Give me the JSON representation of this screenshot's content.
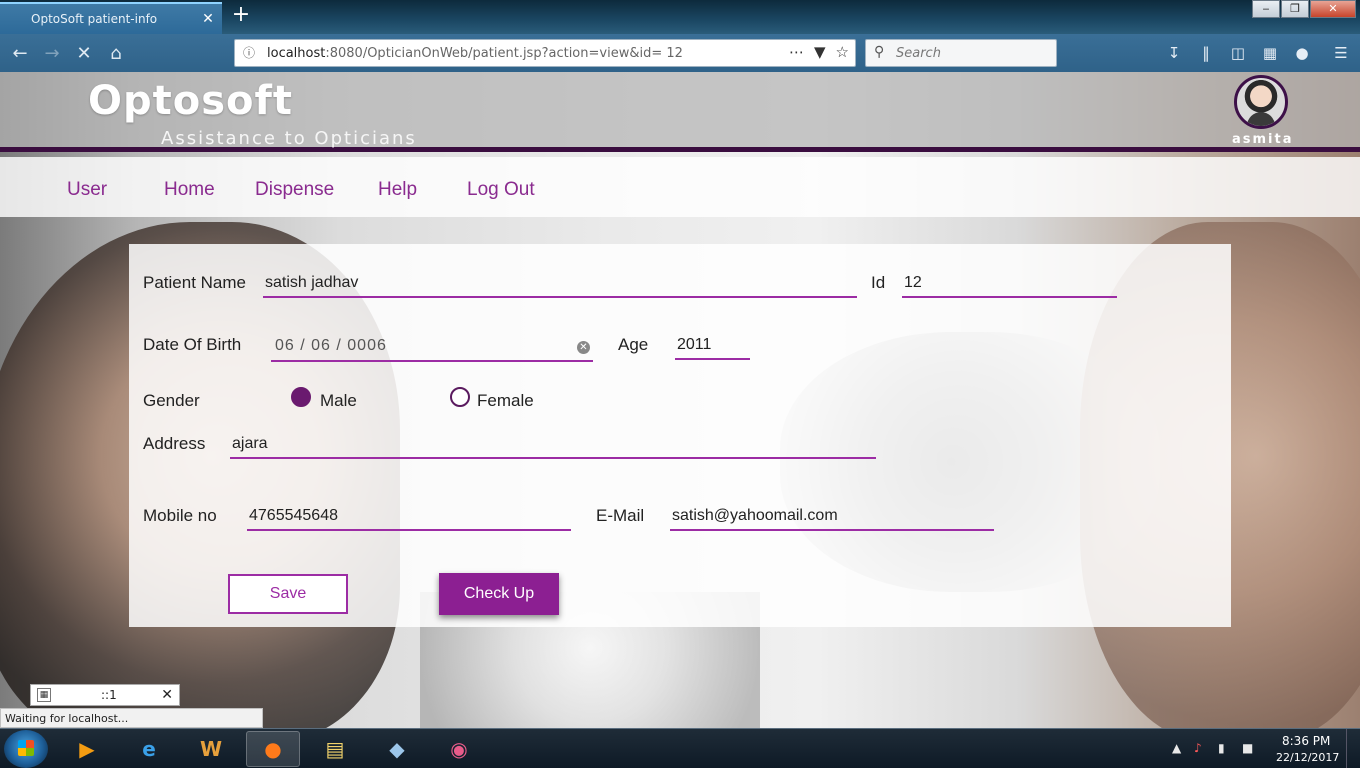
{
  "browser": {
    "tab_title": "OptoSoft patient-info",
    "tab_close": "✕",
    "new_tab": "+",
    "url_host": "localhost",
    "url_rest": ":8080/OpticianOnWeb/patient.jsp?action=view&id= 12",
    "search_placeholder": "Search",
    "window_buttons": {
      "minimize": "‒",
      "maximize": "❐",
      "close": "✕"
    }
  },
  "header": {
    "brand": "Optosoft",
    "tagline": "Assistance to Opticians",
    "username": "asmita"
  },
  "menu": {
    "items": [
      "User",
      "Home",
      "Dispense",
      "Help",
      "Log Out"
    ]
  },
  "form": {
    "patient_name_label": "Patient Name",
    "patient_name_value": "satish jadhav",
    "id_label": "Id",
    "id_value": "12",
    "dob_label": "Date Of Birth",
    "dob_value": "06 / 06 / 0006",
    "age_label": "Age",
    "age_value": "2011",
    "gender_label": "Gender",
    "gender_options": [
      "Male",
      "Female"
    ],
    "gender_selected": "Male",
    "address_label": "Address",
    "address_value": "ajara",
    "mobile_label": "Mobile no",
    "mobile_value": "4765545648",
    "email_label": "E-Mail",
    "email_value": "satish@yahoomail.com",
    "save_label": "Save",
    "checkup_label": "Check Up"
  },
  "overlays": {
    "popup_text": "::1",
    "status_text": "Waiting for localhost..."
  },
  "taskbar": {
    "time": "8:36 PM",
    "date": "22/12/2017"
  },
  "colors": {
    "accent": "#9c2ca4",
    "header_border": "#3a0d3f",
    "menu_text": "#8a2b8f"
  }
}
